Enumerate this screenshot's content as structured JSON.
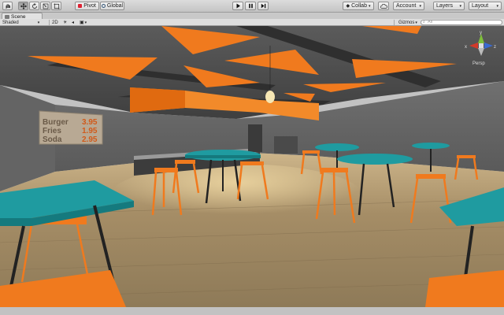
{
  "toolbar": {
    "pivot_label": "Pivot",
    "global_label": "Global",
    "collab_label": "Collab",
    "account_label": "Account",
    "layers_label": "Layers",
    "layout_label": "Layout"
  },
  "tabs": [
    {
      "label": "Scene"
    }
  ],
  "scene_toolbar": {
    "shading_mode": "Shaded",
    "mode_2d": "2D",
    "gizmos_label": "Gizmos",
    "search_placeholder": "All"
  },
  "menu_board": {
    "items": [
      {
        "name": "Burger",
        "price": "3.95"
      },
      {
        "name": "Fries",
        "price": "1.95"
      },
      {
        "name": "Soda",
        "price": "2.95"
      }
    ]
  },
  "gizmo": {
    "projection": "Persp",
    "axis_x": "x",
    "axis_y": "y",
    "axis_z": "z"
  },
  "colors": {
    "accent_orange": "#f07a1e",
    "table_teal": "#1f9ba0",
    "wall_gray": "#6e6e6e",
    "floor_wood": "#a8906a"
  },
  "icons": {
    "hand": "hand-tool-icon",
    "move": "move-tool-icon",
    "rotate": "rotate-tool-icon",
    "scale": "scale-tool-icon",
    "rect": "rect-tool-icon",
    "play": "play-icon",
    "pause": "pause-icon",
    "step": "step-icon",
    "cloud": "cloud-icon"
  }
}
